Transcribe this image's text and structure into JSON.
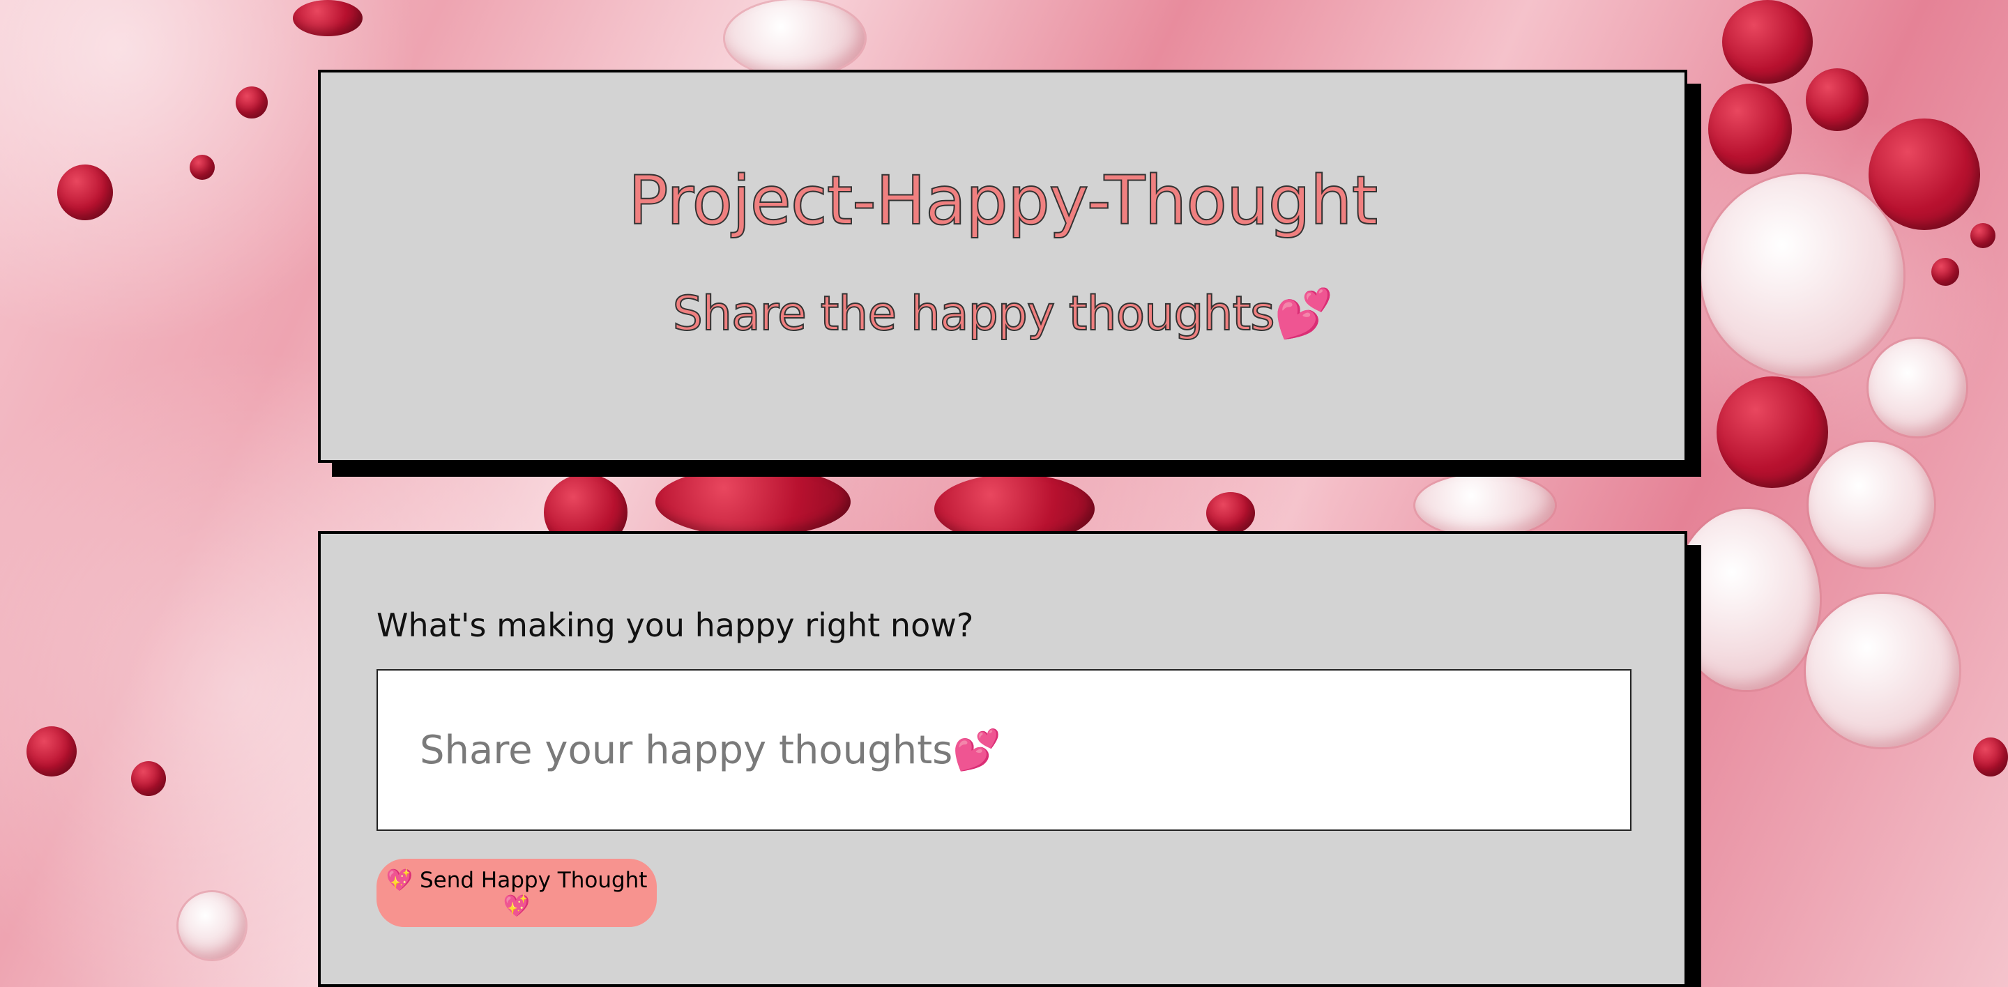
{
  "header": {
    "title": "Project-Happy-Thought",
    "subtitle": "Share the happy thoughts💕"
  },
  "form": {
    "label": "What's making you happy right now?",
    "input_placeholder": "Share your happy thoughts💕",
    "input_value": "",
    "send_button_label": "💖 Send Happy Thought💖"
  },
  "colors": {
    "card_background": "#d3d3d3",
    "title_color": "#f08080",
    "button_color": "#f7938f",
    "border_color": "#000000"
  }
}
